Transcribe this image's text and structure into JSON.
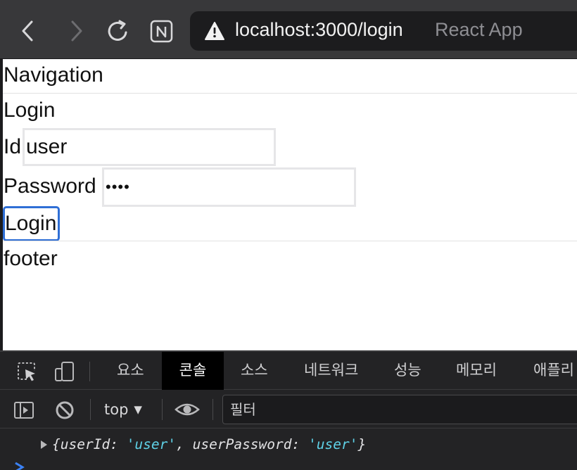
{
  "browser": {
    "url": "localhost:3000/login",
    "page_title": "React App"
  },
  "page": {
    "nav_title": "Navigation",
    "login_heading": "Login",
    "id_label": "Id",
    "id_value": "user",
    "password_label": "Password",
    "password_masked": "••••",
    "login_button": "Login",
    "footer": "footer"
  },
  "devtools": {
    "tabs": [
      "요소",
      "콘솔",
      "소스",
      "네트워크",
      "성능",
      "메모리",
      "애플리"
    ],
    "active_tab": "콘솔",
    "context": "top",
    "filter_placeholder": "필터",
    "console_entry": {
      "open": "{",
      "key1": "userId",
      "val1": "'user'",
      "key2": "userPassword",
      "val2": "'user'",
      "close": "}"
    },
    "accent_color": "#5fd2e8"
  }
}
